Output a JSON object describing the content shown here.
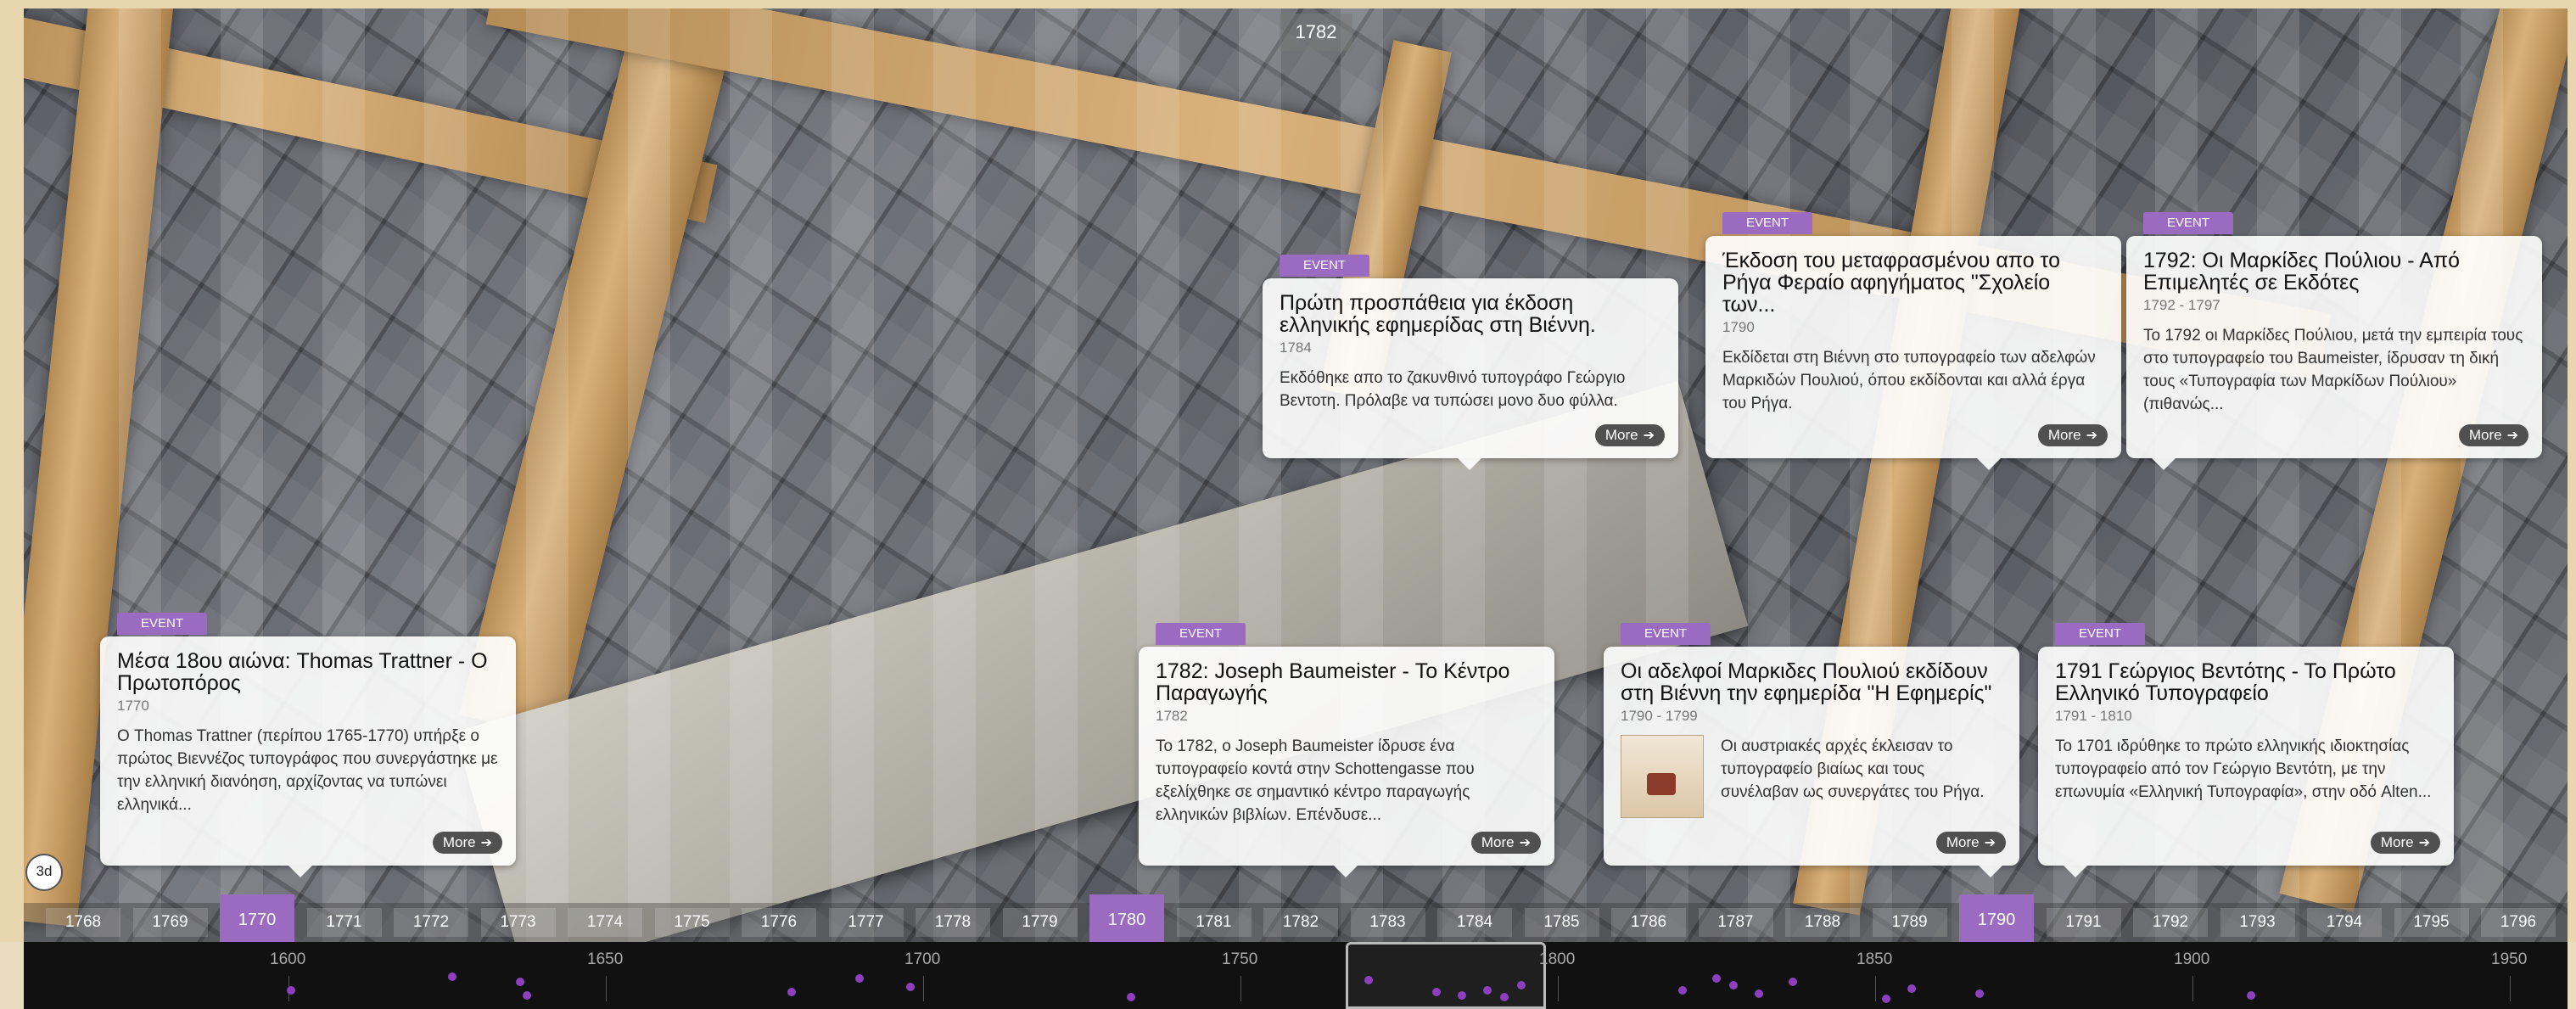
{
  "header": {
    "current_year": "1782",
    "view_badge": "3d"
  },
  "event_tag": "EVENT",
  "more_label": "More",
  "colors": {
    "accent": "#9b6bc1",
    "minimap_dot": "#8e3fc0"
  },
  "events": [
    {
      "title": "Μέσα 18ου αιώνα: Thomas Trattner - Ο Πρωτοπόρος",
      "date": "1770",
      "body": "Ο Thomas Trattner (περίπου 1765-1770) υπήρξε ο πρώτος Βιεννέζος τυπογράφος που συνεργάστηκε με την ελληνική διανόηση, αρχίζοντας να τυπώνει ελληνικά..."
    },
    {
      "title": "1782: Joseph Baumeister - Το Κέντρο Παραγωγής",
      "date": "1782",
      "body": "Το 1782, ο Joseph Baumeister ίδρυσε ένα τυπογραφείο κοντά στην Schottengasse που εξελίχθηκε σε σημαντικό κέντρο παραγωγής ελληνικών βιβλίων. Επένδυσε..."
    },
    {
      "title": "Πρώτη προσπάθεια για έκδοση ελληνικής εφημερίδας στη Βιέννη.",
      "date": "1784",
      "body": "Εκδόθηκε απο το ζακυνθινό τυπογράφο Γεώργιο Βεντοτη. Πρόλαβε να τυπώσει μονο δυο φύλλα."
    },
    {
      "title": "Οι αδελφοί Μαρκιδες Πουλιού εκδίδουν στη Βιέννη την εφημερίδα \"Η Εφημερίς\"",
      "date": "1790 - 1799",
      "body": "Οι αυστριακές αρχές έκλεισαν το τυπογραφείο βιαίως και τους συνέλαβαν ως συνεργάτες του Ρήγα."
    },
    {
      "title": "Έκδοση του μεταφρασμένου απο το Ρήγα Φεραίο αφηγήματος \"Σχολείο των...",
      "date": "1790",
      "body": "Εκδίδεται στη Βιέννη στο τυπογραφείο των αδελφών Μαρκιδών Πουλιού, όπου εκδίδονται και αλλά έργα του Ρήγα."
    },
    {
      "title": "1791 Γεώργιος Βεντότης - Το Πρώτο Ελληνικό Τυπογραφείο",
      "date": "1791 - 1810",
      "body": "Το 1701 ιδρύθηκε το πρώτο ελληνικής ιδιοκτησίας τυπογραφείο από τον Γεώργιο Βεντότη, με την επωνυμία «Ελληνική Τυπογραφία», στην οδό Alten..."
    },
    {
      "title": "1792: Οι Μαρκίδες Πούλιου - Από Επιμελητές σε Εκδότες",
      "date": "1792 - 1797",
      "body": "Το 1792 οι Μαρκίδες Πούλιου, μετά την εμπειρία τους στο τυπογραφείο του Baumeister, ίδρυσαν τη δική τους «Τυπογραφία των Μαρκίδων Πούλιου» (πιθανώς..."
    }
  ],
  "timeline_years": [
    "1768",
    "1769",
    "1770",
    "1771",
    "1772",
    "1773",
    "1774",
    "1775",
    "1776",
    "1777",
    "1778",
    "1779",
    "1780",
    "1781",
    "1782",
    "1783",
    "1784",
    "1785",
    "1786",
    "1787",
    "1788",
    "1789",
    "1790",
    "1791",
    "1792",
    "1793",
    "1794",
    "1795",
    "1796"
  ],
  "highlighted_years": [
    "1770",
    "1780",
    "1790"
  ],
  "minimap_labels": [
    "1600",
    "1650",
    "1700",
    "1750",
    "1800",
    "1850",
    "1900",
    "1950"
  ]
}
